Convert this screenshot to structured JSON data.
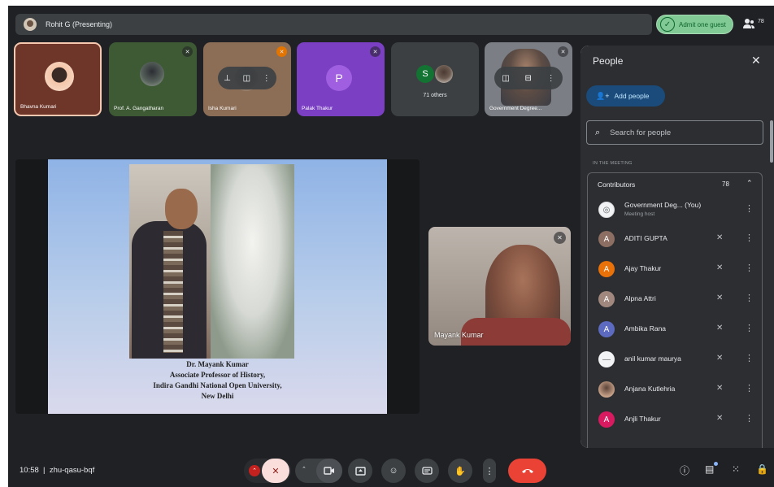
{
  "presenting": {
    "label": "Rohit G (Presenting)"
  },
  "header": {
    "admit_label": "Admit one guest",
    "participant_count": "78"
  },
  "tiles": [
    {
      "name": "Bhavna Kumari"
    },
    {
      "name": "Prof. A. Gangatharan"
    },
    {
      "name": "Isha Kumari"
    },
    {
      "name": "Palak Thakur",
      "initial": "P"
    },
    {
      "name": "71 others",
      "initial": "S"
    },
    {
      "name": "Government Degree..."
    }
  ],
  "slide": {
    "line1": "Dr. Mayank Kumar",
    "line2": "Associate Professor of History,",
    "line3": "Indira Gandhi National Open University,",
    "line4": "New Delhi"
  },
  "speaker": {
    "name": "Mayank Kumar"
  },
  "panel": {
    "title": "People",
    "add_people_label": "Add people",
    "search_placeholder": "Search for people",
    "section_label": "IN THE MEETING",
    "group_label": "Contributors",
    "group_count": "78",
    "people": [
      {
        "name": "Government Deg... (You)",
        "sub": "Meeting host",
        "initial": "",
        "color": "#f1f3f4"
      },
      {
        "name": "ADITI GUPTA",
        "initial": "A",
        "color": "#8d6e63"
      },
      {
        "name": "Ajay Thakur",
        "initial": "A",
        "color": "#e8710a"
      },
      {
        "name": "Alpna Attri",
        "initial": "A",
        "color": "#a1887f"
      },
      {
        "name": "Ambika Rana",
        "initial": "A",
        "color": "#5c6bc0"
      },
      {
        "name": "anil kumar maurya",
        "initial": "",
        "color": "#f1f3f4"
      },
      {
        "name": "Anjana Kutlehria",
        "initial": "",
        "color": "#c9a38a"
      },
      {
        "name": "Anjli Thakur",
        "initial": "A",
        "color": "#d81b60"
      }
    ]
  },
  "bottom": {
    "time": "10:58",
    "meeting_code": "zhu-qasu-bqf"
  },
  "colors": {
    "background": "#202124",
    "panel": "#2d2e31",
    "leave": "#ea4335",
    "admit": "#81c995"
  }
}
